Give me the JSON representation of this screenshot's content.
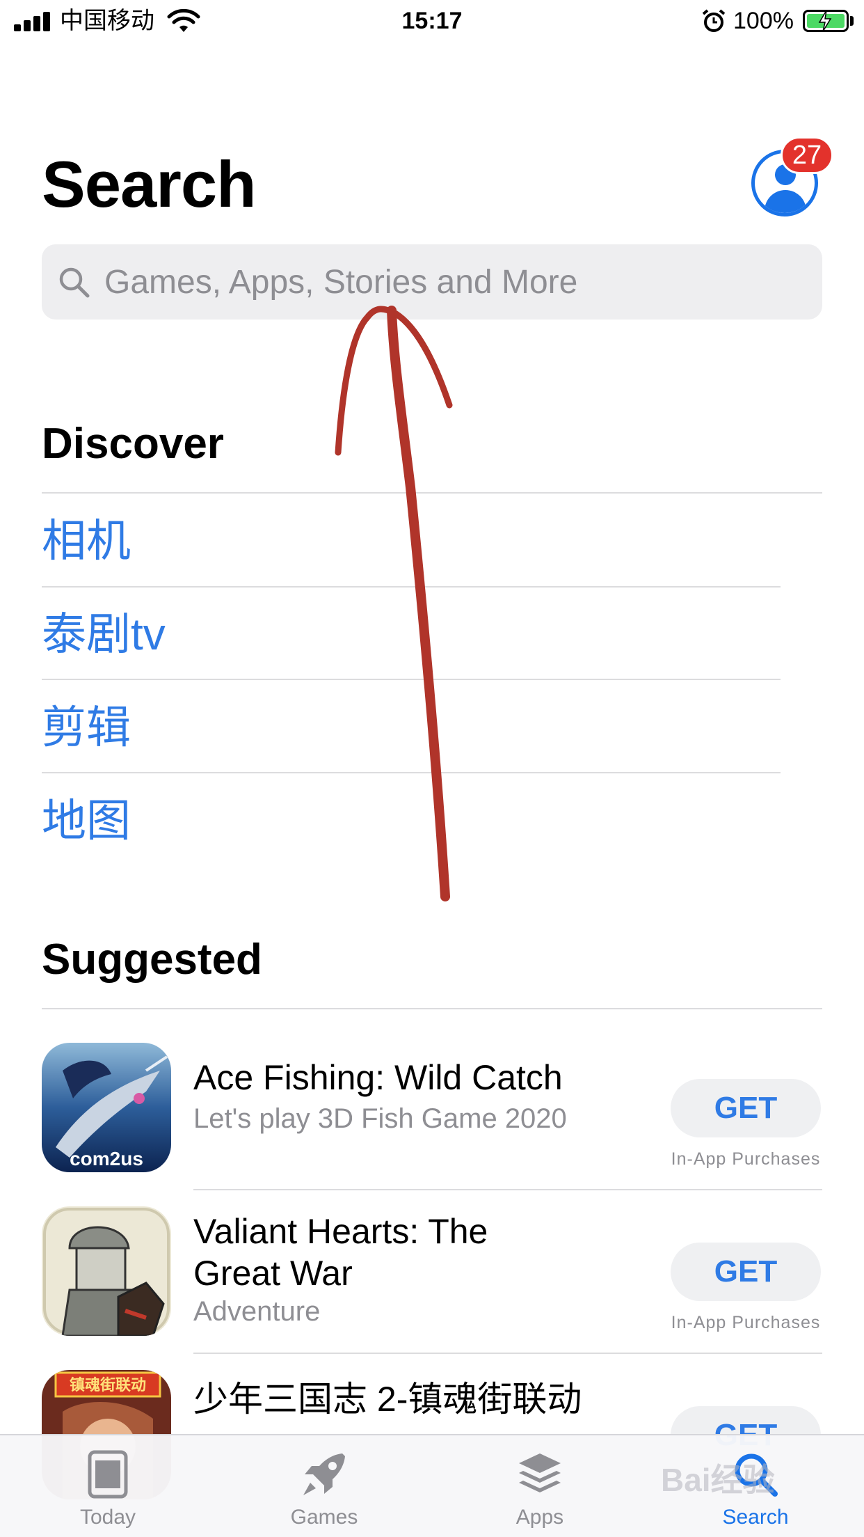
{
  "status_bar": {
    "carrier": "中国移动",
    "time": "15:17",
    "battery": "100%"
  },
  "header": {
    "title": "Search",
    "account_badge": "27"
  },
  "search": {
    "placeholder": "Games, Apps, Stories and More"
  },
  "discover": {
    "title": "Discover",
    "items": [
      "相机",
      "泰剧tv",
      "剪辑",
      "地图"
    ]
  },
  "suggested": {
    "title": "Suggested",
    "apps": [
      {
        "name": "Ace Fishing: Wild Catch",
        "subtitle": "Let's play 3D Fish Game 2020",
        "button": "GET",
        "note": "In-App Purchases",
        "icon_text": "com2us"
      },
      {
        "name": "Valiant Hearts: The Great War",
        "subtitle": "Adventure",
        "button": "GET",
        "note": "In-App Purchases"
      },
      {
        "name": "少年三国志 2-镇魂街联动",
        "subtitle": "",
        "button": "GET",
        "note": "",
        "icon_text": "镇魂街联动"
      }
    ]
  },
  "tabs": [
    {
      "label": "Today",
      "icon": "today-icon",
      "active": false
    },
    {
      "label": "Games",
      "icon": "rocket-icon",
      "active": false
    },
    {
      "label": "Apps",
      "icon": "layers-icon",
      "active": false
    },
    {
      "label": "Search",
      "icon": "search-icon",
      "active": true
    }
  ],
  "watermark": "Bai经验",
  "colors": {
    "link": "#2f7be5",
    "accent": "#1a73e8",
    "badge": "#e3322c",
    "annotation": "#b0342a"
  }
}
